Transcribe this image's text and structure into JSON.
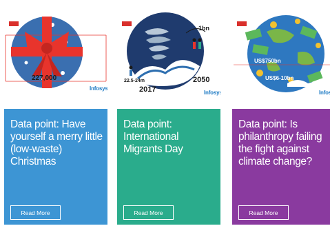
{
  "cards": [
    {
      "panel_color": "#3d95d4",
      "title": "Data point: Have yourself a merry little (low-waste) Christmas",
      "button": "Read More",
      "art_label": "227,000",
      "brand": "Infosys"
    },
    {
      "panel_color": "#2aac8c",
      "title": "Data point: International Migrants Day",
      "button": "Read More",
      "art_labels": [
        "1bn",
        "22.5-24m",
        "2017",
        "2050"
      ],
      "brand": "Infosys"
    },
    {
      "panel_color": "#8a3a9f",
      "title": "Data point: Is philanthropy failing the fight against climate change?",
      "button": "Read More",
      "art_labels": [
        "US$750bn",
        "US$6-10bn"
      ],
      "brand": "Infosys"
    }
  ]
}
